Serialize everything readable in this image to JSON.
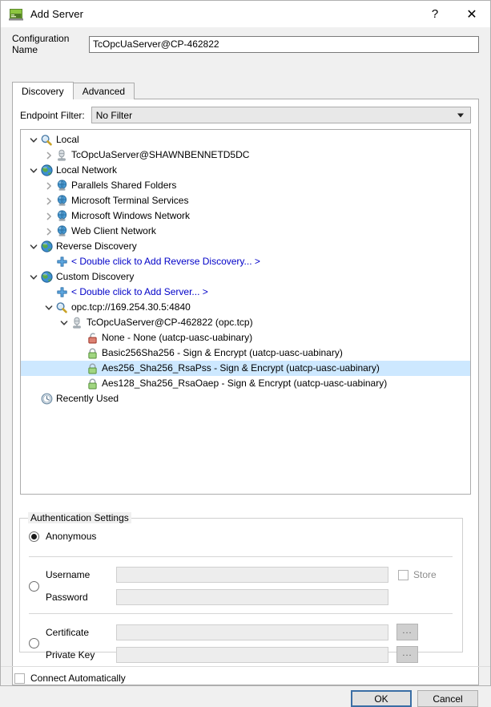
{
  "window": {
    "title": "Add Server",
    "app_icon": "server-app-icon",
    "help_button": "?",
    "close_button": "✕"
  },
  "config": {
    "label": "Configuration Name",
    "value": "TcOpcUaServer@CP-462822",
    "placeholder": ""
  },
  "tabs": [
    {
      "label": "Discovery",
      "active": true
    },
    {
      "label": "Advanced",
      "active": false
    }
  ],
  "endpoint_filter": {
    "label": "Endpoint Filter:",
    "value": "No Filter",
    "options": [
      "No Filter"
    ]
  },
  "tree": {
    "selected_index": 15,
    "rows": [
      {
        "indent": 0,
        "chevron": "down",
        "icon": "magnifier-icon",
        "label": "Local",
        "link": false
      },
      {
        "indent": 1,
        "chevron": "right",
        "icon": "server-icon",
        "label": "TcOpcUaServer@SHAWNBENNETD5DC",
        "link": false
      },
      {
        "indent": 0,
        "chevron": "down",
        "icon": "globe-icon",
        "label": "Local Network",
        "link": false
      },
      {
        "indent": 1,
        "chevron": "right",
        "icon": "network-icon",
        "label": "Parallels Shared Folders",
        "link": false
      },
      {
        "indent": 1,
        "chevron": "right",
        "icon": "network-icon",
        "label": "Microsoft Terminal Services",
        "link": false
      },
      {
        "indent": 1,
        "chevron": "right",
        "icon": "network-icon",
        "label": "Microsoft Windows Network",
        "link": false
      },
      {
        "indent": 1,
        "chevron": "right",
        "icon": "network-icon",
        "label": "Web Client Network",
        "link": false
      },
      {
        "indent": 0,
        "chevron": "down",
        "icon": "globe-icon",
        "label": "Reverse Discovery",
        "link": false
      },
      {
        "indent": 1,
        "chevron": "none",
        "icon": "plus-icon",
        "label": "< Double click to Add Reverse Discovery... >",
        "link": true
      },
      {
        "indent": 0,
        "chevron": "down",
        "icon": "globe-icon",
        "label": "Custom Discovery",
        "link": false
      },
      {
        "indent": 1,
        "chevron": "none",
        "icon": "plus-icon",
        "label": "< Double click to Add Server... >",
        "link": true
      },
      {
        "indent": 1,
        "chevron": "down",
        "icon": "magnifier-icon",
        "label": "opc.tcp://169.254.30.5:4840",
        "link": false
      },
      {
        "indent": 2,
        "chevron": "down",
        "icon": "server-icon",
        "label": "TcOpcUaServer@CP-462822 (opc.tcp)",
        "link": false
      },
      {
        "indent": 3,
        "chevron": "none",
        "icon": "lock-open-icon",
        "label": "None - None (uatcp-uasc-uabinary)",
        "link": false
      },
      {
        "indent": 3,
        "chevron": "none",
        "icon": "lock-icon",
        "label": "Basic256Sha256 - Sign & Encrypt (uatcp-uasc-uabinary)",
        "link": false
      },
      {
        "indent": 3,
        "chevron": "none",
        "icon": "lock-icon",
        "label": "Aes256_Sha256_RsaPss - Sign & Encrypt (uatcp-uasc-uabinary)",
        "link": false
      },
      {
        "indent": 3,
        "chevron": "none",
        "icon": "lock-icon",
        "label": "Aes128_Sha256_RsaOaep - Sign & Encrypt (uatcp-uasc-uabinary)",
        "link": false
      },
      {
        "indent": 0,
        "chevron": "none",
        "icon": "clock-icon",
        "label": "Recently Used",
        "link": false
      }
    ],
    "selected_row_label": "None - None (uatcp-uasc-uabinary)"
  },
  "auth": {
    "legend": "Authentication Settings",
    "anonymous": {
      "label": "Anonymous",
      "checked": true
    },
    "userpass": {
      "checked": false,
      "username_label": "Username",
      "username_value": "",
      "password_label": "Password",
      "password_value": "",
      "store_label": "Store",
      "store_checked": false
    },
    "certificate": {
      "checked": false,
      "certificate_label": "Certificate",
      "certificate_value": "",
      "private_key_label": "Private Key",
      "private_key_value": "",
      "browse_label": "..."
    }
  },
  "footer": {
    "connect_automatically": {
      "label": "Connect Automatically",
      "checked": false
    },
    "ok_label": "OK",
    "cancel_label": "Cancel"
  },
  "colors": {
    "link": "#0000c8",
    "selection": "#cde8ff",
    "default_button_border": "#3a6ea5",
    "lock_closed": "#7fba5a",
    "lock_open": "#c0392b",
    "plus": "#4a90d9"
  }
}
